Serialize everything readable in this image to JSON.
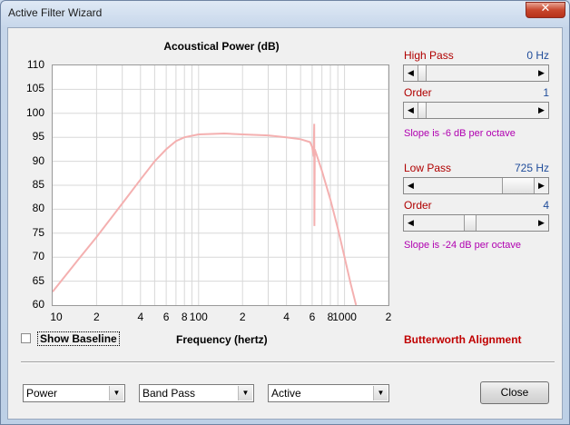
{
  "window": {
    "title": "Active Filter Wizard",
    "close_glyph": "✕"
  },
  "chart": {
    "title": "Acoustical Power (dB)",
    "x_title": "Frequency (hertz)",
    "y_ticks": [
      "110",
      "105",
      "100",
      "95",
      "90",
      "85",
      "80",
      "75",
      "70",
      "65",
      "60"
    ],
    "x_ticks": [
      "10",
      "2",
      "4",
      "6",
      "8",
      "100",
      "2",
      "4",
      "6",
      "8",
      "1000",
      "2"
    ]
  },
  "chart_data": {
    "type": "line",
    "title": "Acoustical Power (dB)",
    "xlabel": "Frequency (hertz)",
    "ylabel": "",
    "xscale": "log",
    "xlim": [
      10,
      2000
    ],
    "ylim": [
      60,
      110
    ],
    "grid": true,
    "series": [
      {
        "color": "#f4b0b0",
        "x": [
          10,
          15,
          20,
          30,
          40,
          50,
          60,
          70,
          80,
          100,
          150,
          200,
          300,
          400,
          500,
          580,
          600,
          615,
          620,
          622,
          625,
          700,
          800,
          900,
          1000,
          1100,
          1200
        ],
        "y": [
          62.8,
          69.5,
          74.2,
          81.2,
          86.2,
          90.0,
          92.5,
          94.2,
          95.0,
          95.6,
          95.8,
          95.6,
          95.4,
          95.0,
          94.6,
          94.0,
          93.0,
          91.0,
          97.8,
          76.5,
          92.5,
          88.0,
          82.0,
          76.0,
          70.0,
          64.5,
          60.0
        ]
      }
    ]
  },
  "controls": {
    "show_baseline_label": "Show Baseline",
    "show_baseline_checked": false,
    "high_pass": {
      "label": "High Pass",
      "value": "0 Hz",
      "position": 0.0
    },
    "high_pass_order": {
      "label": "Order",
      "value": "1",
      "position": 0.0
    },
    "high_pass_slope": "Slope is -6 dB per octave",
    "low_pass": {
      "label": "Low Pass",
      "value": "725 Hz",
      "position": 0.78
    },
    "low_pass_order": {
      "label": "Order",
      "value": "4",
      "position": 0.5
    },
    "low_pass_slope": "Slope is -24 dB per octave",
    "alignment": "Butterworth Alignment"
  },
  "footer": {
    "combo1": "Power",
    "combo2": "Band Pass",
    "combo3": "Active",
    "close_label": "Close"
  },
  "colors": {
    "curve": "#f4b0b0",
    "label_red": "#b00000",
    "value_blue": "#1f4c9a",
    "hint_magenta": "#b000b0",
    "alignment_red": "#c00000"
  }
}
